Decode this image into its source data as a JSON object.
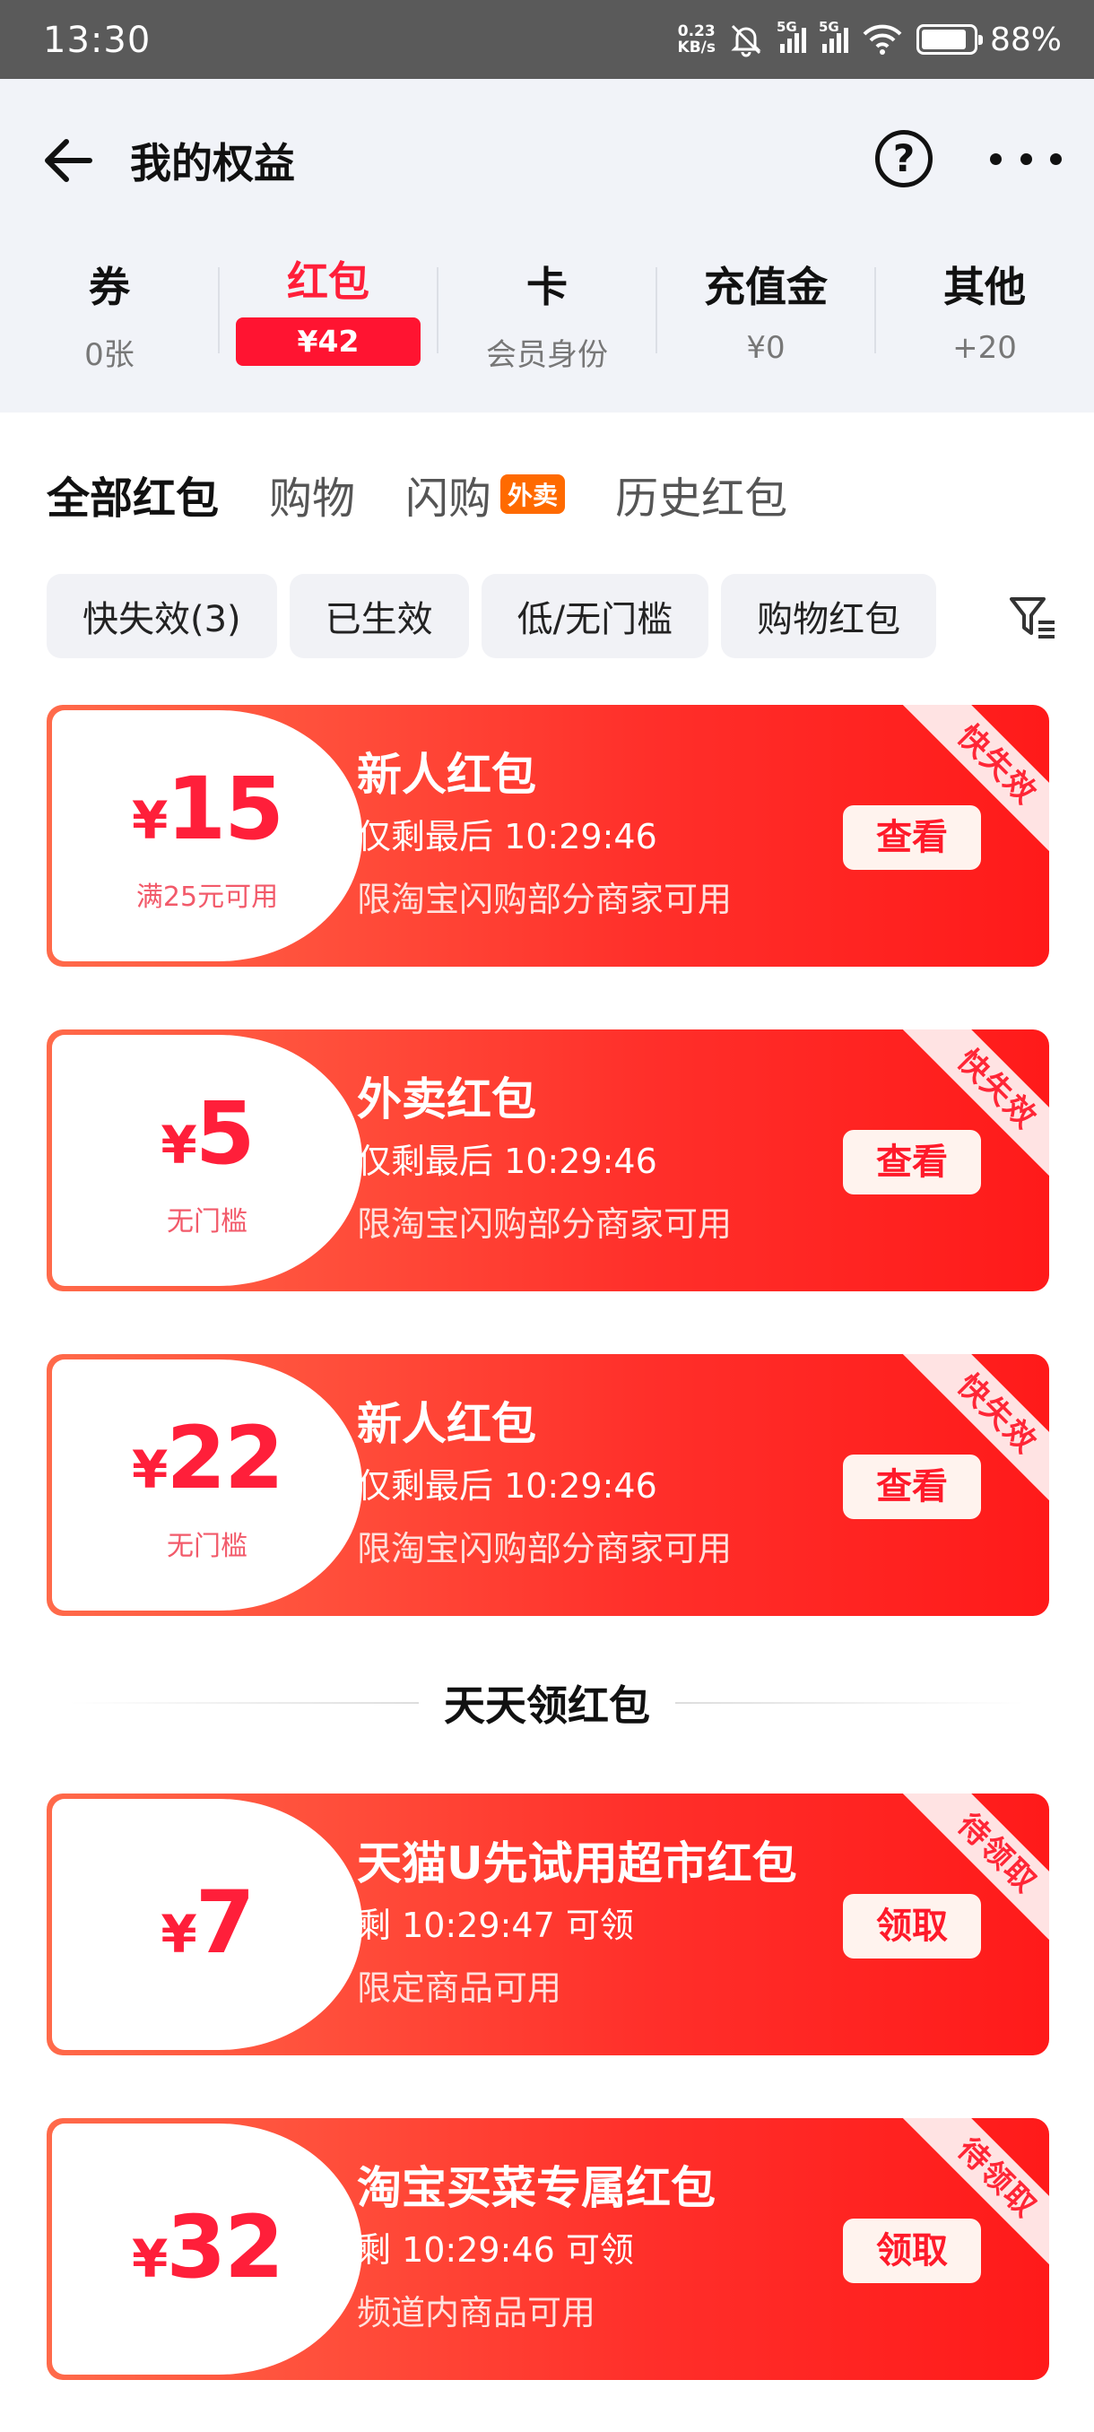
{
  "status_bar": {
    "time": "13:30",
    "net_speed_value": "0.23",
    "net_speed_unit": "KB/s",
    "signal1": "5G",
    "signal2": "5G",
    "battery_pct": "88%",
    "battery_level": 0.88
  },
  "nav": {
    "title": "我的权益",
    "help_label": "?"
  },
  "categories": [
    {
      "name": "券",
      "sub": "0张"
    },
    {
      "name": "红包",
      "sub": "¥42"
    },
    {
      "name": "卡",
      "sub": "会员身份"
    },
    {
      "name": "充值金",
      "sub": "¥0"
    },
    {
      "name": "其他",
      "sub": "+20"
    }
  ],
  "tabs": [
    {
      "label": "全部红包"
    },
    {
      "label": "购物"
    },
    {
      "label": "闪购",
      "badge": "外卖"
    },
    {
      "label": "历史红包"
    }
  ],
  "filters": [
    "快失效(3)",
    "已生效",
    "低/无门槛",
    "购物红包"
  ],
  "cards": [
    {
      "currency": "¥",
      "amount": "15",
      "condition": "满25元可用",
      "name": "新人红包",
      "time": "仅剩最后 10:29:46",
      "rule": "限淘宝闪购部分商家可用",
      "button": "查看",
      "ribbon": "快失效"
    },
    {
      "currency": "¥",
      "amount": "5",
      "condition": "无门槛",
      "name": "外卖红包",
      "time": "仅剩最后 10:29:46",
      "rule": "限淘宝闪购部分商家可用",
      "button": "查看",
      "ribbon": "快失效"
    },
    {
      "currency": "¥",
      "amount": "22",
      "condition": "无门槛",
      "name": "新人红包",
      "time": "仅剩最后 10:29:46",
      "rule": "限淘宝闪购部分商家可用",
      "button": "查看",
      "ribbon": "快失效"
    }
  ],
  "section_title": "天天领红包",
  "daily_cards": [
    {
      "currency": "¥",
      "amount": "7",
      "name": "天猫U先试用超市红包",
      "time": "剩 10:29:47 可领",
      "rule": "限定商品可用",
      "button": "领取",
      "ribbon": "待领取"
    },
    {
      "currency": "¥",
      "amount": "32",
      "name": "淘宝买菜专属红包",
      "time": "剩 10:29:46 可领",
      "rule": "频道内商品可用",
      "button": "领取",
      "ribbon": "待领取"
    }
  ]
}
